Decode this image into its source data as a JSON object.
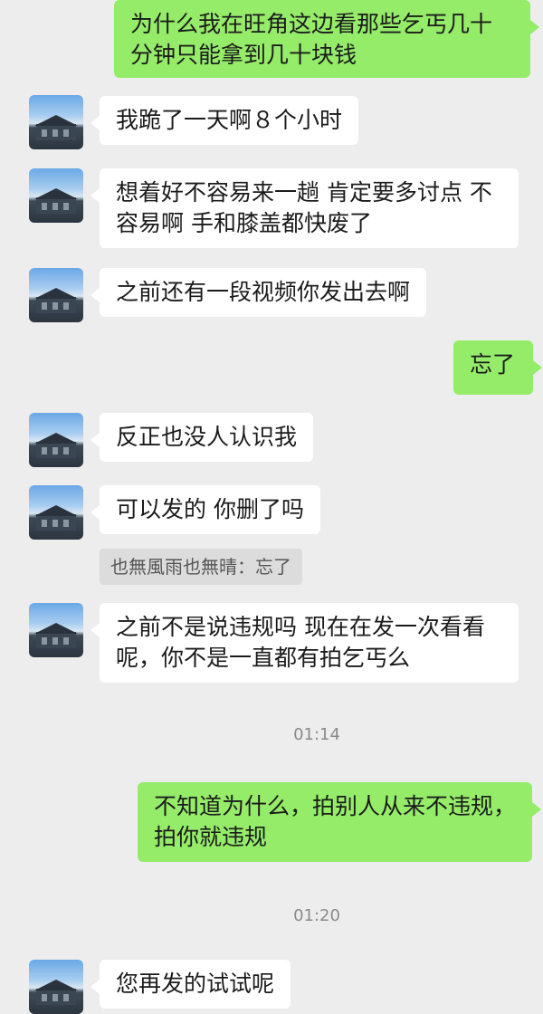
{
  "colors": {
    "background": "#ededed",
    "incoming_bubble": "#ffffff",
    "outgoing_bubble": "#95ec69",
    "quote_bg": "#dcdcdc"
  },
  "messages": [
    {
      "side": "right",
      "text": "为什么我在旺角这边看那些乞丐几十\n分钟只能拿到几十块钱"
    },
    {
      "side": "left",
      "text": "我跪了一天啊８个小时"
    },
    {
      "side": "left",
      "text": "想着好不容易来一趟 肯定要多讨点 不\n容易啊 手和膝盖都快废了"
    },
    {
      "side": "left",
      "text": "之前还有一段视频你发出去啊"
    },
    {
      "side": "right",
      "text": "忘了"
    },
    {
      "side": "left",
      "text": "反正也没人认识我"
    },
    {
      "side": "left",
      "text": "可以发的 你删了吗"
    },
    {
      "side": "left",
      "text": "之前不是说违规吗 现在在发一次看看\n呢，你不是一直都有拍乞丐么"
    },
    {
      "side": "right",
      "text": "不知道为什么，拍别人从来不违规，\n拍你就违规"
    },
    {
      "side": "left",
      "text": "您再发的试试呢"
    }
  ],
  "quote": {
    "author": "也無風雨也無晴",
    "text": "忘了"
  },
  "timestamps": [
    "01:14",
    "01:20"
  ]
}
